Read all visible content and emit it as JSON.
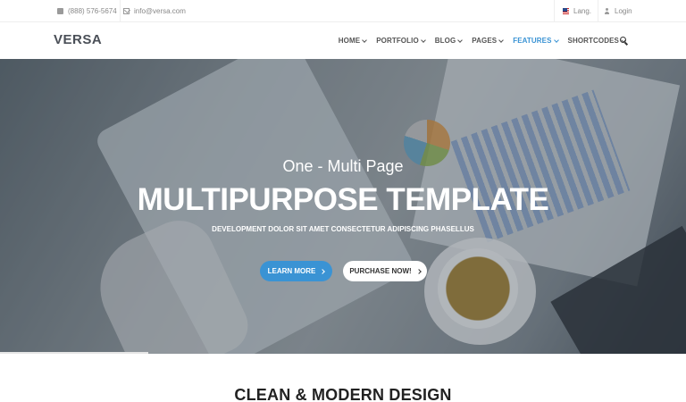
{
  "topbar": {
    "phone": "(888) 576-5674",
    "email": "info@versa.com",
    "lang_label": "Lang.",
    "login_label": "Login"
  },
  "header": {
    "logo": "VERSA",
    "nav": [
      {
        "label": "HOME",
        "active": false
      },
      {
        "label": "PORTFOLIO",
        "active": false
      },
      {
        "label": "BLOG",
        "active": false
      },
      {
        "label": "PAGES",
        "active": false
      },
      {
        "label": "FEATURES",
        "active": true
      },
      {
        "label": "SHORTCODES",
        "active": false
      }
    ]
  },
  "hero": {
    "subtitle": "One - Multi Page",
    "title": "MULTIPURPOSE TEMPLATE",
    "description": "DEVELOPMENT DOLOR SIT AMET CONSECTETUR ADIPISCING PHASELLUS",
    "primary_button": "LEARN MORE",
    "secondary_button": "PURCHASE NOW!"
  },
  "section": {
    "title": "CLEAN & MODERN DESIGN"
  },
  "colors": {
    "accent": "#3a93d4",
    "logo": "#4a4f57"
  }
}
